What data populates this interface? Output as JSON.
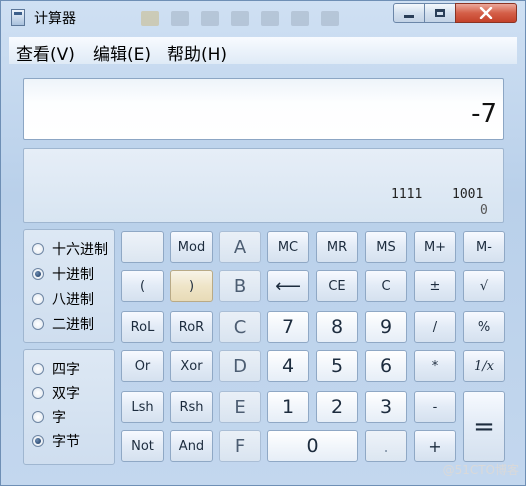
{
  "window": {
    "title": "计算器"
  },
  "menu": [
    "查看(V)",
    "编辑(E)",
    "帮助(H)"
  ],
  "display": {
    "value": "-7"
  },
  "bits": {
    "row1_left": "1111",
    "row1_right": "1001",
    "row2_right": "0"
  },
  "base": {
    "options": [
      "十六进制",
      "十进制",
      "八进制",
      "二进制"
    ],
    "selected": "十进制"
  },
  "word": {
    "options": [
      "四字",
      "双字",
      "字",
      "字节"
    ],
    "selected": "字节"
  },
  "keys": {
    "mod": "Mod",
    "A": "A",
    "MC": "MC",
    "MR": "MR",
    "MS": "MS",
    "Mplus": "M+",
    "Mminus": "M-",
    "lparen": "(",
    "rparen": ")",
    "B": "B",
    "back": "⟵",
    "CE": "CE",
    "C": "C",
    "pm": "±",
    "sqrt": "√",
    "RoL": "RoL",
    "RoR": "RoR",
    "Ckey": "C",
    "n7": "7",
    "n8": "8",
    "n9": "9",
    "div": "/",
    "pct": "%",
    "Or": "Or",
    "Xor": "Xor",
    "D": "D",
    "n4": "4",
    "n5": "5",
    "n6": "6",
    "mul": "*",
    "recip": "1/x",
    "Lsh": "Lsh",
    "Rsh": "Rsh",
    "E": "E",
    "n1": "1",
    "n2": "2",
    "n3": "3",
    "sub": "-",
    "eq": "=",
    "Not": "Not",
    "And": "And",
    "F": "F",
    "n0": "0",
    "dot": ".",
    "add": "+"
  },
  "watermark": "@51CTO博客"
}
